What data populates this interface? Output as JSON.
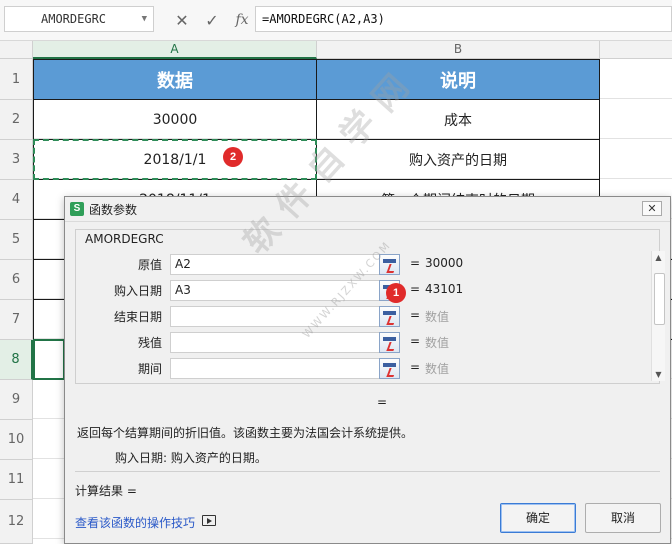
{
  "formula_bar": {
    "name_box": "AMORDEGRC",
    "cancel_icon": "✕",
    "confirm_icon": "✓",
    "fx_label": "fx",
    "formula": "=AMORDEGRC(A2,A3)"
  },
  "sheet": {
    "columns": [
      "A",
      "B"
    ],
    "rows": [
      "1",
      "2",
      "3",
      "4",
      "5",
      "6",
      "7",
      "8",
      "9",
      "10",
      "11",
      "12"
    ],
    "header": [
      "数据",
      "说明"
    ],
    "data": [
      [
        "30000",
        "成本"
      ],
      [
        "2018/1/1",
        "购入资产的日期"
      ],
      [
        "2018/11/1",
        "第一个期间结束时的日期"
      ]
    ],
    "header_color": "#5b9bd5"
  },
  "badges": [
    "1",
    "2"
  ],
  "dialog": {
    "title": "函数参数",
    "close": "✕",
    "function_name": "AMORDEGRC",
    "args": [
      {
        "label": "原值",
        "input": "A2",
        "value": "30000"
      },
      {
        "label": "购入日期",
        "input": "A3",
        "value": "43101"
      },
      {
        "label": "结束日期",
        "input": "",
        "value": "数值"
      },
      {
        "label": "残值",
        "input": "",
        "value": "数值"
      },
      {
        "label": "期间",
        "input": "",
        "value": "数值"
      }
    ],
    "equals": "=",
    "result_equals": "=",
    "description": "返回每个结算期间的折旧值。该函数主要为法国会计系统提供。",
    "arg_description": "购入日期:  购入资产的日期。",
    "result_label": "计算结果  =",
    "help_link": "查看该函数的操作技巧",
    "ok": "确定",
    "cancel": "取消"
  },
  "watermark": {
    "main": "软件自学网",
    "sub": "WWW.RJZXW.COM"
  }
}
